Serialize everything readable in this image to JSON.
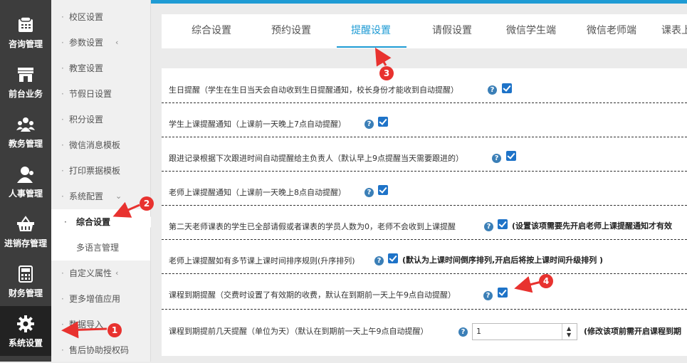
{
  "nav": [
    {
      "label": "咨询管理",
      "icon": "phone-icon"
    },
    {
      "label": "前台业务",
      "icon": "store-icon"
    },
    {
      "label": "教务管理",
      "icon": "users-icon"
    },
    {
      "label": "人事管理",
      "icon": "person-icon"
    },
    {
      "label": "进销存管理",
      "icon": "basket-icon"
    },
    {
      "label": "财务管理",
      "icon": "calculator-icon"
    },
    {
      "label": "系统设置",
      "icon": "gear-icon"
    }
  ],
  "submenu": [
    {
      "label": "校区设置"
    },
    {
      "label": "参数设置",
      "chevron": "‹"
    },
    {
      "label": "教室设置"
    },
    {
      "label": "节假日设置"
    },
    {
      "label": "积分设置"
    },
    {
      "label": "微信消息模板"
    },
    {
      "label": "打印票据模板",
      "chevron": "‹"
    },
    {
      "label": "系统配置",
      "chevron": "⌄"
    },
    {
      "label": "综合设置"
    },
    {
      "label": "多语言管理"
    },
    {
      "label": "自定义属性",
      "chevron": "‹"
    },
    {
      "label": "更多增值应用",
      "chevron": "‹"
    },
    {
      "label": "数据导入"
    },
    {
      "label": "售后协助授权码"
    }
  ],
  "tabs": [
    "综合设置",
    "预约设置",
    "提醒设置",
    "请假设置",
    "微信学生端",
    "微信老师端",
    "课表上"
  ],
  "active_tab": "提醒设置",
  "settings": [
    {
      "label": "生日提醒（学生在生日当天会自动收到生日提醒通知，校长身份才能收到自动提醒）",
      "checked": true
    },
    {
      "label": "学生上课提醒通知（上课前一天晚上7点自动提醒）",
      "checked": true
    },
    {
      "label": "跟进记录根据下次跟进时间自动提醒给主负责人（默认早上9点提醒当天需要跟进的）",
      "checked": true
    },
    {
      "label": "老师上课提醒通知（上课前一天晚上8点自动提醒）",
      "checked": true
    },
    {
      "label": "第二天老师课表的学生已全部请假或者课表的学员人数为0，老师不会收到上课提醒",
      "checked": true,
      "note": "(设置该项需要先开启老师上课提醒通知才有效"
    },
    {
      "label": "老师上课提醒如有多节课上课时间排序规则(升序排列)",
      "checked": true,
      "note": "(默认为上课时间倒序排列,开启后将按上课时间升级排列 )"
    },
    {
      "label": "课程到期提醒（交费时设置了有效期的收费，默认在到期前一天上午9点自动提醒）",
      "checked": true
    },
    {
      "label": "课程到期提前几天提醒（单位为天）（默认在到期前一天上午9点自动提醒）",
      "value": "1",
      "note": "(修改该项前需开启课程到期"
    }
  ],
  "help_glyph": "?",
  "badges": [
    "1",
    "2",
    "3",
    "4"
  ],
  "colors": {
    "accent": "#1e9bd4",
    "annotation": "#e8322f",
    "nav_bg": "#3d3d3d"
  }
}
